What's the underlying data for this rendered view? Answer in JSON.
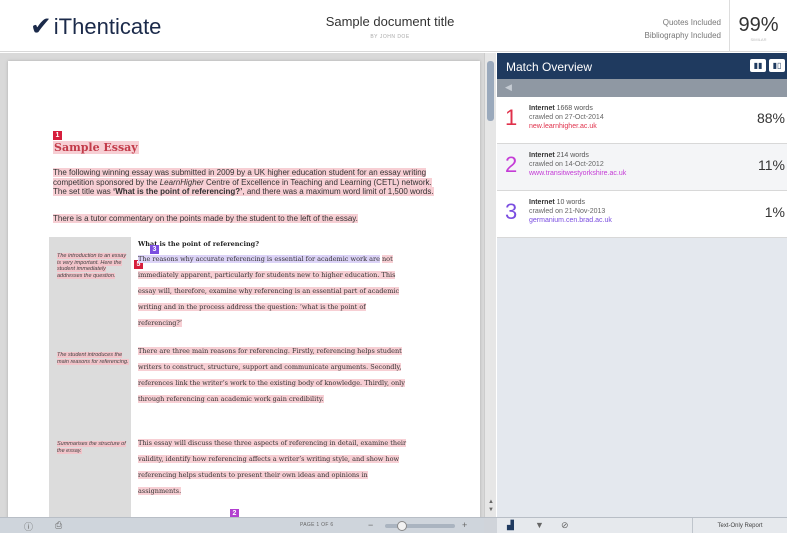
{
  "header": {
    "logo_text": "iThenticate",
    "logo_check": "✔",
    "document_title": "Sample document title",
    "document_author": "BY JOHN DOE",
    "quotes_filter": "Quotes Included",
    "bibliography_filter": "Bibliography Included",
    "similarity_score": "99%",
    "similarity_label": "SIMILAR"
  },
  "document": {
    "markers": [
      "1",
      "3",
      "5",
      "2"
    ],
    "title": "Sample Essay",
    "intro_parts": [
      "The following winning essay was submitted in 2009 by a UK higher education student for an essay writing competition sponsored by the ",
      "LearnHigher",
      " Centre of Excellence in Teaching and Learning (CETL) network. The set title was ",
      "‘What is the point of referencing?’",
      ", and there was a maximum word limit of 1,500 words."
    ],
    "commentary": "There is a tutor commentary on the points made by the student to the left of the essay.",
    "notes": [
      "The introduction to an essay is very important. Here the student immediately addresses the question.",
      "The student introduces the main reasons for referencing.",
      "Summarises the structure of the essay."
    ],
    "body_heading": "What is the point of referencing?",
    "para1_violet": "The reasons why accurate referencing is essential for academic work are",
    "para1_rest": "not immediately apparent, particularly for students new to higher education. This essay will, therefore, examine why referencing is an essential part of academic writing and in the process address the question: ‘what is the point of referencing?’",
    "para2": "There are three main reasons for referencing. Firstly, referencing helps student writers to construct, structure, support and communicate arguments. Secondly, references link the writer’s work to the existing body of knowledge. Thirdly, only through referencing can academic work gain credibility.",
    "para3": "This essay will discuss these three aspects of referencing in detail, examine their validity, identify how referencing affects a writer’s writing style, and show how referencing helps students to present their own ideas and opinions in assignments."
  },
  "match_panel": {
    "title": "Match Overview",
    "back_icon": "◀",
    "view_icons": [
      "▮▮",
      "▮▯"
    ],
    "matches": [
      {
        "rank": "1",
        "type": "Internet",
        "words": "1668 words",
        "date": "crawled on 27-Oct-2014",
        "url": "new.learnhigher.ac.uk",
        "percent": "88%",
        "color": "#e0314b"
      },
      {
        "rank": "2",
        "type": "Internet",
        "words": "214 words",
        "date": "crawled on 14-Oct-2012",
        "url": "www.transitwestyorkshire.ac.uk",
        "percent": "11%",
        "color": "#c43bd6"
      },
      {
        "rank": "3",
        "type": "Internet",
        "words": "10 words",
        "date": "crawled on 21-Nov-2013",
        "url": "germanium.cen.brad.ac.uk",
        "percent": "1%",
        "color": "#7a4de0"
      }
    ]
  },
  "toolbar": {
    "info_icon": "ⓘ",
    "print_icon": "⎙",
    "page_indicator": "PAGE 1 OF 6",
    "zoom_out_icon": "−",
    "zoom_in_icon": "+",
    "zoom_level": 0.2,
    "bar_chart_icon": "▟",
    "filter_icon": "▼",
    "exclude_icon": "⊘",
    "text_only_label": "Text-Only Report"
  },
  "colors": {
    "brand_navy": "#1f3a5f",
    "match_red": "#e0314b",
    "match_purple": "#c43bd6",
    "match_violet": "#7a4de0",
    "highlight_pink": "#f7cfd4"
  }
}
